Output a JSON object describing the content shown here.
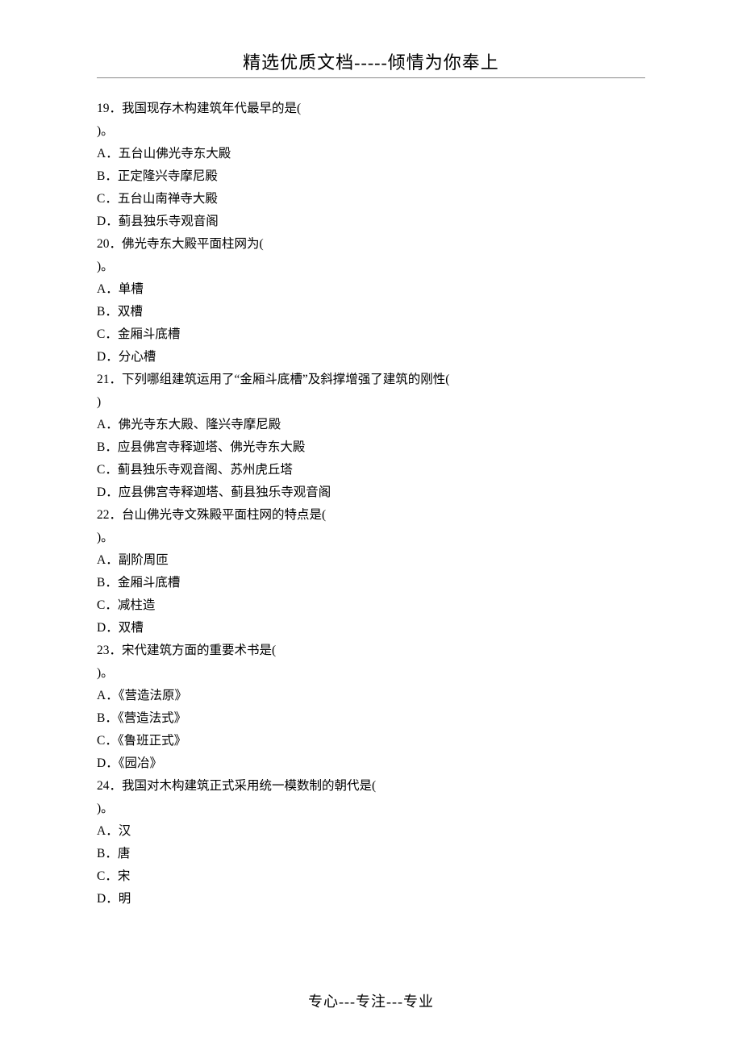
{
  "header": "精选优质文档-----倾情为你奉上",
  "lines": [
    "19．我国现存木构建筑年代最早的是(",
    ")。",
    "A．五台山佛光寺东大殿",
    "B．正定隆兴寺摩尼殿",
    "C．五台山南禅寺大殿",
    "D．蓟县独乐寺观音阁",
    "20．佛光寺东大殿平面柱网为(",
    ")。",
    "A．单槽",
    "B．双槽",
    "C．金厢斗底槽",
    "D．分心槽",
    "21．下列哪组建筑运用了“金厢斗底槽”及斜撑增强了建筑的刚性(",
    ")",
    "A．佛光寺东大殿、隆兴寺摩尼殿",
    "B．应县佛宫寺释迦塔、佛光寺东大殿",
    "C．蓟县独乐寺观音阁、苏州虎丘塔",
    "D．应县佛宫寺释迦塔、蓟县独乐寺观音阁",
    "22．台山佛光寺文殊殿平面柱网的特点是(",
    ")。",
    "A．副阶周匝",
    "B．金厢斗底槽",
    "C．减柱造",
    "D．双槽",
    "23．宋代建筑方面的重要术书是(",
    ")。",
    "A．《营造法原》",
    "B．《营造法式》",
    "C．《鲁班正式》",
    "D．《园冶》",
    "24．我国对木构建筑正式采用统一模数制的朝代是(",
    ")。",
    "A．汉",
    "B．唐",
    "C．宋",
    "D．明"
  ],
  "footer": "专心---专注---专业"
}
